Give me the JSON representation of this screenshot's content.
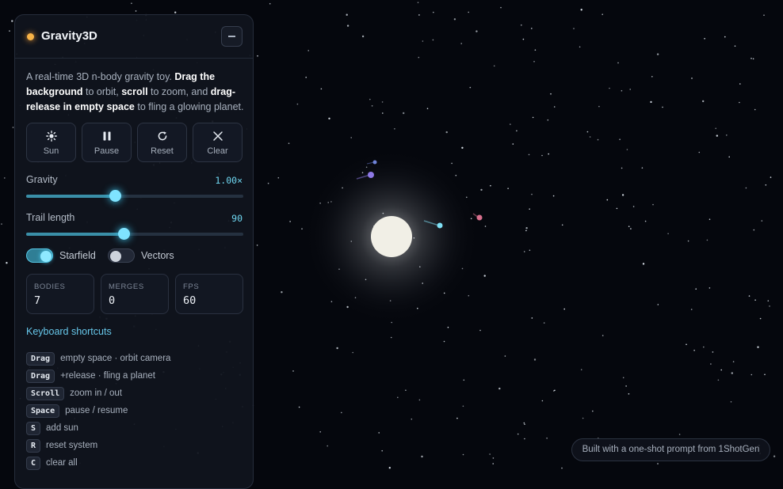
{
  "app": {
    "title": "Gravity3D"
  },
  "description": {
    "t1": "A real-time 3D n-body gravity toy. ",
    "b1": "Drag the background",
    "t2": " to orbit, ",
    "b2": "scroll",
    "t3": " to zoom, and ",
    "b3": "drag-release in empty space",
    "t4": " to fling a glowing planet."
  },
  "controls": [
    {
      "label": "Sun",
      "icon": "sun-icon"
    },
    {
      "label": "Pause",
      "icon": "pause-icon"
    },
    {
      "label": "Reset",
      "icon": "reset-icon"
    },
    {
      "label": "Clear",
      "icon": "close-icon"
    }
  ],
  "sliders": {
    "gravity": {
      "label": "Gravity",
      "value": "1.00×",
      "fraction": 0.407
    },
    "trail": {
      "label": "Trail length",
      "value": "90",
      "fraction": 0.45
    }
  },
  "toggles": {
    "starfield": {
      "label": "Starfield",
      "on": true
    },
    "vectors": {
      "label": "Vectors",
      "on": false
    }
  },
  "stats": [
    {
      "label": "BODIES",
      "value": "7"
    },
    {
      "label": "MERGES",
      "value": "0"
    },
    {
      "label": "FPS",
      "value": "60"
    }
  ],
  "shortcuts": {
    "heading": "Keyboard shortcuts",
    "items": [
      {
        "key": "Drag",
        "desc": "empty space · orbit camera"
      },
      {
        "key": "Drag",
        "desc": "+release · fling a planet"
      },
      {
        "key": "Scroll",
        "desc": "zoom in / out"
      },
      {
        "key": "Space",
        "desc": "pause / resume"
      },
      {
        "key": "S",
        "desc": "add sun"
      },
      {
        "key": "R",
        "desc": "reset system"
      },
      {
        "key": "C",
        "desc": "clear all"
      }
    ]
  },
  "footer": {
    "badge": "Built with a one-shot prompt from 1ShotGen"
  },
  "colors": {
    "accent": "#6fd8f2",
    "sun": "#f1efe6",
    "background": "#05070d"
  },
  "scene": {
    "sun_color": "#f1efe6",
    "planet_colors": [
      "#8e79e6",
      "#6f83d9",
      "#7fe0f5",
      "#d86f8d"
    ]
  }
}
